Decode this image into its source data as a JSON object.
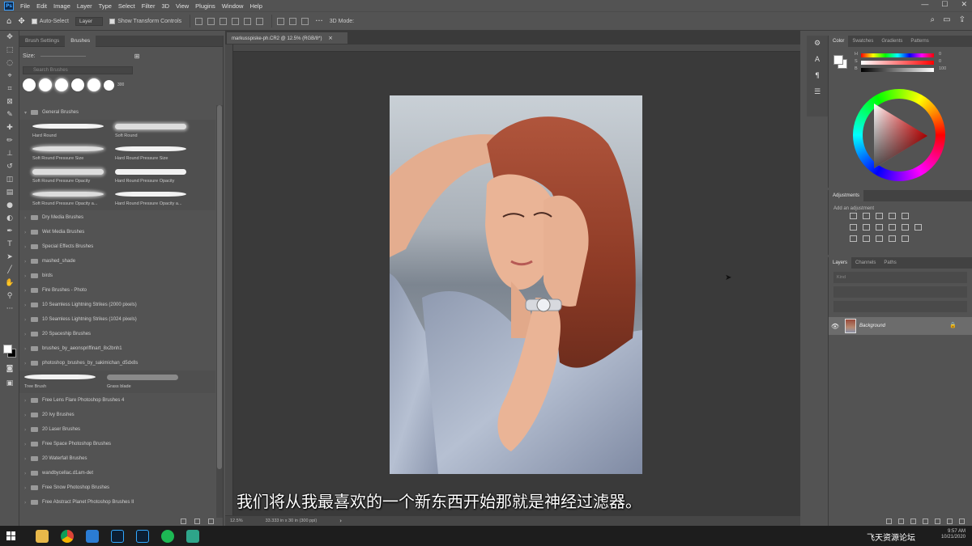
{
  "app": {
    "logo_text": "Ps"
  },
  "menu": [
    "File",
    "Edit",
    "Image",
    "Layer",
    "Type",
    "Select",
    "Filter",
    "3D",
    "View",
    "Plugins",
    "Window",
    "Help"
  ],
  "window_controls": [
    "—",
    "☐",
    "✕"
  ],
  "options_bar": {
    "auto_select_label": "Auto-Select",
    "auto_select_value": "Layer",
    "transform_label": "Show Transform Controls",
    "mode_label": "3D Mode:"
  },
  "brush_panel": {
    "tabs": [
      "Brush Settings",
      "Brushes"
    ],
    "size_label": "Size:",
    "search_placeholder": "Search Brushes",
    "tip_size": "300",
    "general_folder": "General Brushes",
    "general_brushes": [
      "Hard Round",
      "Soft Round",
      "Soft Round Pressure Size",
      "Hard Round Pressure Size",
      "Soft Round Pressure Opacity",
      "Hard Round Pressure Opacity",
      "Soft Round Pressure Opacity a...",
      "Hard Round Pressure Opacity a..."
    ],
    "folders_a": [
      "Dry Media Brushes",
      "Wet Media Brushes",
      "Special Effects Brushes",
      "mashed_shade",
      "birds",
      "Fire Brushes - Photo",
      "10 Seamless Lightning Strikes (2000 pixels)",
      "10 Seamless Lightning Strikes (1024 pixels)",
      "20 Spaceship Brushes",
      "brushes_by_aeonspriffinart_8x2bnh1",
      "photoshop_brushes_by_sakimichan_d5dx8s"
    ],
    "extra_brushes": [
      "Tree Brush",
      "Grass blade"
    ],
    "folders_b": [
      "Free Lens Flare Photoshop Brushes 4",
      "20 Ivy Brushes",
      "20 Laser Brushes",
      "Free Space Photoshop Brushes",
      "20 Waterfall Brushes",
      "wandbycellac.d1am-det",
      "Free Snow Photoshop Brushes",
      "Free Abstract Planet Photoshop Brushes II"
    ]
  },
  "document": {
    "tab_title": "markusspiske-ph.CR2 @ 12.5% (RGB/8*)",
    "status_zoom": "12.5%",
    "status_info": "33.333 in x 30 in (300 ppi)",
    "subtitle": "我们将从我最喜欢的一个新东西开始那就是神经过滤器。"
  },
  "color_panel": {
    "tabs": [
      "Color",
      "Swatches",
      "Gradients",
      "Patterns"
    ],
    "sliders": [
      {
        "label": "H",
        "value": "0"
      },
      {
        "label": "S",
        "value": "0"
      },
      {
        "label": "B",
        "value": "100"
      }
    ]
  },
  "adjustments_panel": {
    "tab": "Adjustments",
    "add_label": "Add an adjustment"
  },
  "layers_panel": {
    "tabs": [
      "Layers",
      "Channels",
      "Paths"
    ],
    "kind_placeholder": "Kind",
    "layer_name": "Background"
  },
  "taskbar": {
    "apps": [
      "File Explorer",
      "Chrome",
      "Mail",
      "Lightroom Classic",
      "Photoshop",
      "Spotify",
      "Terminal"
    ],
    "time": "9:57 AM",
    "date": "10/21/2020",
    "watermark": "飞天资源论坛"
  },
  "colors": {
    "panel_bg": "#535353",
    "canvas_bg": "#3a3a3a",
    "accent_blue": "#3aa0ff"
  }
}
